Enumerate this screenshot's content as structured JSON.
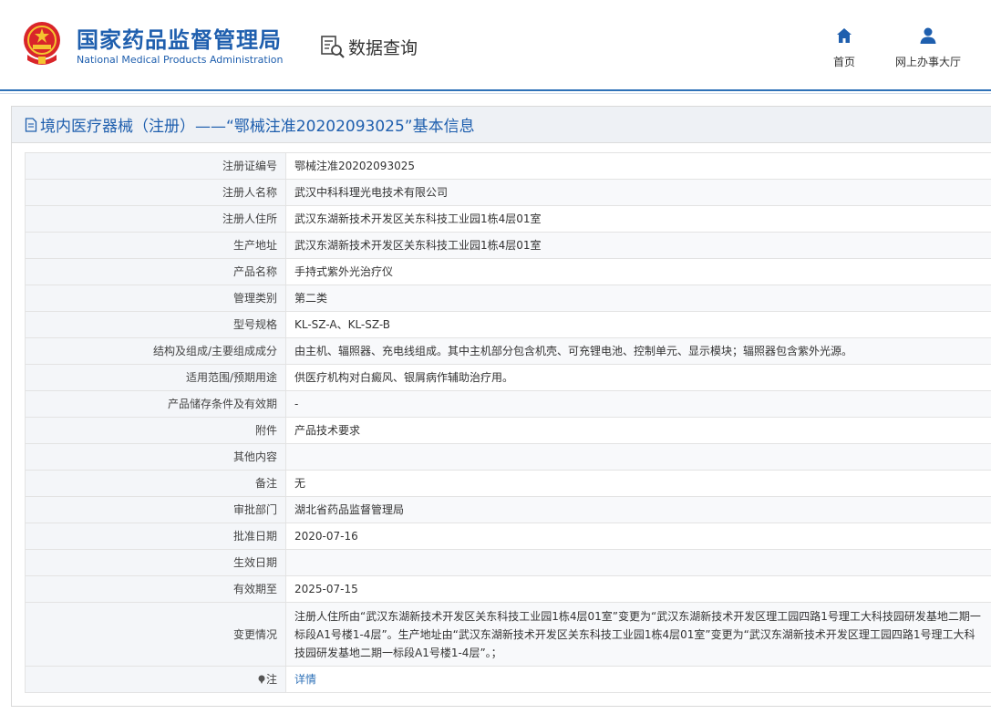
{
  "header": {
    "title_cn": "国家药品监督管理局",
    "title_en": "National Medical Products Administration",
    "module_label": "数据查询",
    "nav": [
      {
        "label": "首页",
        "icon": "home-icon"
      },
      {
        "label": "网上办事大厅",
        "icon": "user-icon"
      }
    ]
  },
  "panel": {
    "title": "境内医疗器械（注册）——“鄂械注准20202093025”基本信息"
  },
  "rows": [
    {
      "label": "注册证编号",
      "value": "鄂械注准20202093025"
    },
    {
      "label": "注册人名称",
      "value": "武汉中科科理光电技术有限公司"
    },
    {
      "label": "注册人住所",
      "value": "武汉东湖新技术开发区关东科技工业园1栋4层01室"
    },
    {
      "label": "生产地址",
      "value": "武汉东湖新技术开发区关东科技工业园1栋4层01室"
    },
    {
      "label": "产品名称",
      "value": "手持式紫外光治疗仪"
    },
    {
      "label": "管理类别",
      "value": "第二类"
    },
    {
      "label": "型号规格",
      "value": "KL-SZ-A、KL-SZ-B"
    },
    {
      "label": "结构及组成/主要组成成分",
      "value": "由主机、辐照器、充电线组成。其中主机部分包含机壳、可充锂电池、控制单元、显示模块；辐照器包含紫外光源。"
    },
    {
      "label": "适用范围/预期用途",
      "value": "供医疗机构对白癜风、银屑病作辅助治疗用。"
    },
    {
      "label": "产品储存条件及有效期",
      "value": "-"
    },
    {
      "label": "附件",
      "value": "产品技术要求"
    },
    {
      "label": "其他内容",
      "value": ""
    },
    {
      "label": "备注",
      "value": "无"
    },
    {
      "label": "审批部门",
      "value": "湖北省药品监督管理局"
    },
    {
      "label": "批准日期",
      "value": "2020-07-16"
    },
    {
      "label": "生效日期",
      "value": ""
    },
    {
      "label": "有效期至",
      "value": "2025-07-15"
    },
    {
      "label": "变更情况",
      "value": "注册人住所由“武汉东湖新技术开发区关东科技工业园1栋4层01室”变更为“武汉东湖新技术开发区理工园四路1号理工大科技园研发基地二期一标段A1号楼1-4层”。生产地址由“武汉东湖新技术开发区关东科技工业园1栋4层01室”变更为“武汉东湖新技术开发区理工园四路1号理工大科技园研发基地二期一标段A1号楼1-4层”。；"
    }
  ],
  "note_row": {
    "label": "注",
    "value": "详情"
  },
  "colors": {
    "brand": "#1f5fae",
    "link": "#2f72b8",
    "label_bg": "#f4f6f9"
  }
}
